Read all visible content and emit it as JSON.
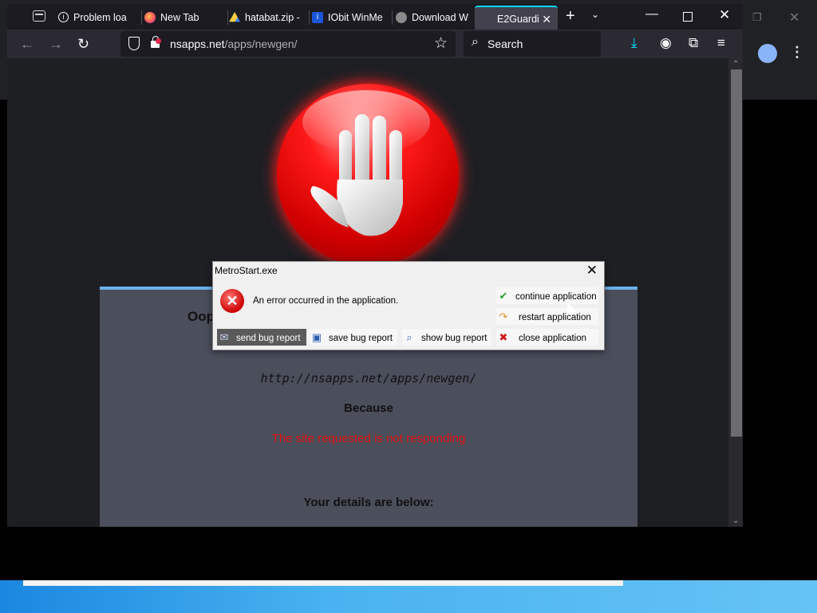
{
  "browser": {
    "tabs": [
      {
        "label": "Problem loa",
        "icon": "info-icon"
      },
      {
        "label": "New Tab",
        "icon": "firefox-icon"
      },
      {
        "label": "hatabat.zip -",
        "icon": "drive-icon"
      },
      {
        "label": "IObit WinMe",
        "icon": "iobit-icon"
      },
      {
        "label": "Download W",
        "icon": "download-site-icon"
      },
      {
        "label": "E2Guardi",
        "icon": "",
        "active": true
      }
    ],
    "url_domain": "nsapps.net",
    "url_path": "/apps/newgen/",
    "search_placeholder": "Search"
  },
  "page": {
    "title_partial": "Oop",
    "url": "http://nsapps.net/apps/newgen/",
    "because": "Because",
    "reason": "The site requested is not responding",
    "details": "Your details are below:"
  },
  "dialog": {
    "title": "MetroStart.exe",
    "message": "An error occurred in the application.",
    "buttons": {
      "continue": "continue application",
      "restart": "restart application",
      "send": "send bug report",
      "save": "save bug report",
      "show": "show bug report",
      "close": "close application"
    }
  },
  "colors": {
    "accent": "#00ddff",
    "panel_top": "#6ab0e8",
    "error_red": "#e01010"
  }
}
